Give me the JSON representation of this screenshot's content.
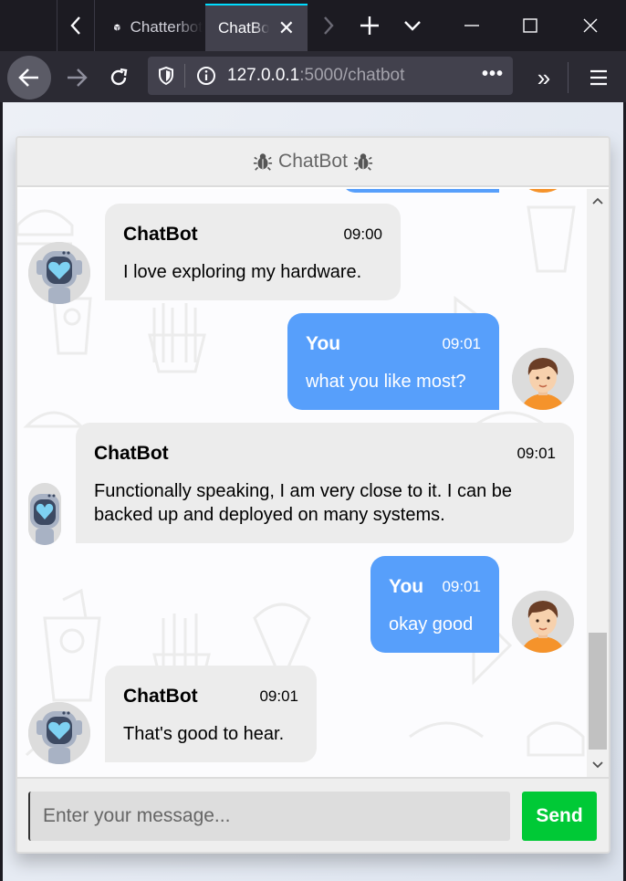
{
  "browser": {
    "tabs": [
      {
        "title": "Chatterbot",
        "active": false
      },
      {
        "title": "ChatBot",
        "active": true
      }
    ],
    "url": {
      "host": "127.0.0.1",
      "rest": ":5000/chatbot"
    }
  },
  "chat": {
    "title": "ChatBot",
    "messages": [
      {
        "side": "left",
        "sender": "ChatBot",
        "time": "09:00",
        "text": "I love exploring my hardware."
      },
      {
        "side": "right",
        "sender": "You",
        "time": "09:01",
        "text": "what you like most?"
      },
      {
        "side": "left",
        "sender": "ChatBot",
        "time": "09:01",
        "text": "Functionally speaking, I am very close to it. I can be backed up and deployed on many systems."
      },
      {
        "side": "right",
        "sender": "You",
        "time": "09:01",
        "text": "okay good"
      },
      {
        "side": "left",
        "sender": "ChatBot",
        "time": "09:01",
        "text": "That's good to hear."
      }
    ],
    "input": {
      "placeholder": "Enter your message...",
      "value": ""
    },
    "send_label": "Send"
  },
  "colors": {
    "user_bubble": "#579ffb",
    "bot_bubble": "#ececec",
    "send_button": "#00c936",
    "header_bg": "#eeeeee",
    "browser_accent": "#00ddff"
  },
  "icons": [
    "back-arrow-icon",
    "forward-arrow-icon",
    "reload-icon",
    "shield-icon",
    "info-icon",
    "more-dots-icon",
    "overflow-chevrons-icon",
    "hamburger-menu-icon",
    "new-tab-plus-icon",
    "tab-list-chevron-icon",
    "minimize-icon",
    "maximize-icon",
    "close-icon",
    "bug-icon",
    "robot-avatar-icon",
    "user-avatar-icon"
  ]
}
